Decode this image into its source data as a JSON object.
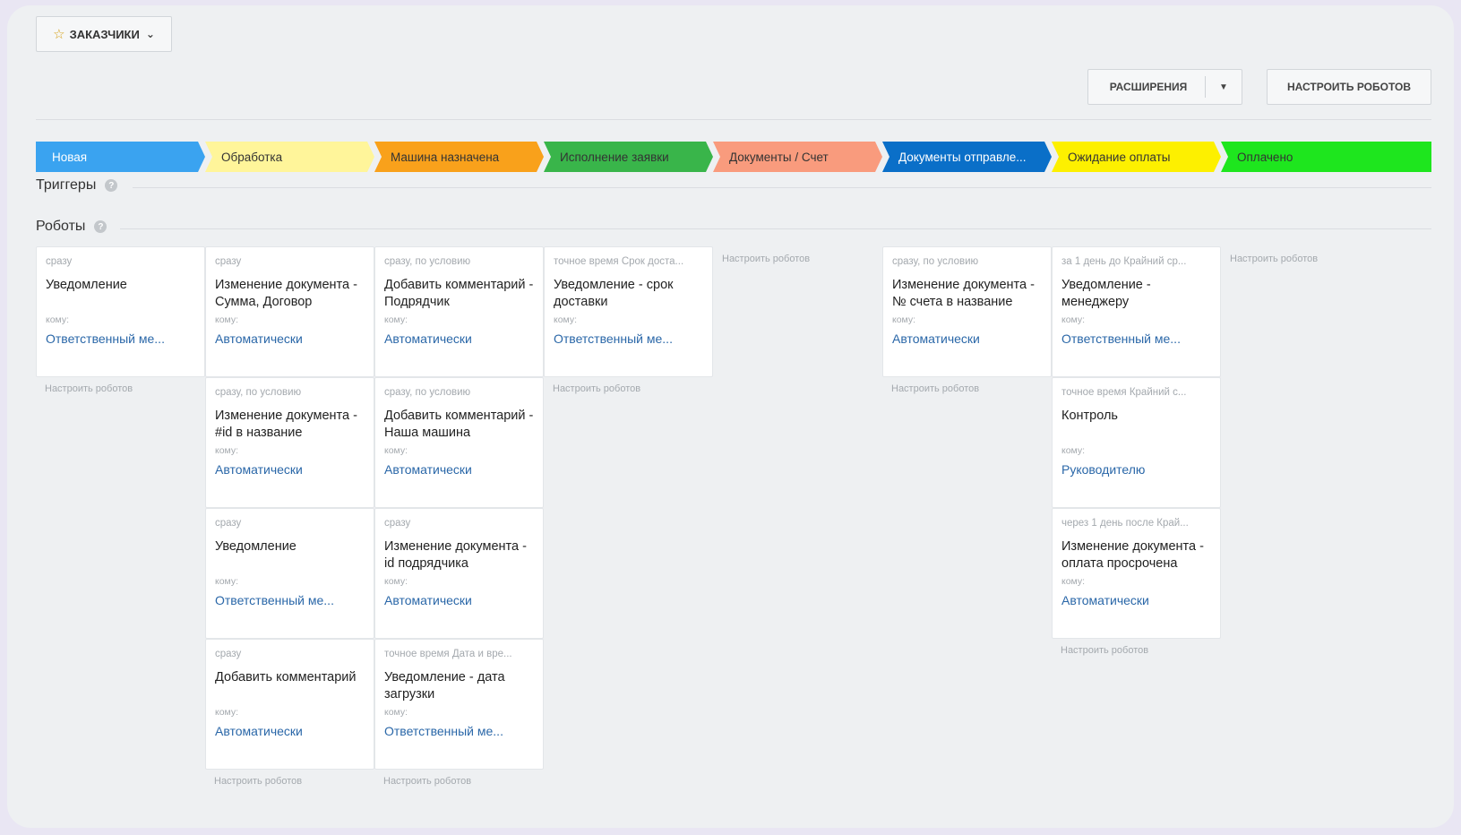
{
  "toolbar": {
    "filter_label": "ЗАКАЗЧИКИ",
    "extensions_label": "РАСШИРЕНИЯ",
    "setup_robots_label": "НАСТРОИТЬ РОБОТОВ"
  },
  "stages": [
    {
      "label": "Новая",
      "color": "#3aa3f0",
      "text_color": "#ffffff"
    },
    {
      "label": "Обработка",
      "color": "#fff59a",
      "text_color": "#333333"
    },
    {
      "label": "Машина назначена",
      "color": "#f9a11b",
      "text_color": "#333333"
    },
    {
      "label": "Исполнение заявки",
      "color": "#39b54a",
      "text_color": "#333333"
    },
    {
      "label": "Документы / Счет",
      "color": "#f99b7d",
      "text_color": "#333333"
    },
    {
      "label": "Документы отправле...",
      "color": "#0a6fc8",
      "text_color": "#ffffff"
    },
    {
      "label": "Ожидание оплаты",
      "color": "#fdf000",
      "text_color": "#333333"
    },
    {
      "label": "Оплачено",
      "color": "#1ee61e",
      "text_color": "#333333"
    }
  ],
  "sections": {
    "triggers": "Триггеры",
    "robots": "Роботы",
    "help_glyph": "?"
  },
  "to_label": "кому:",
  "setup_label": "Настроить роботов",
  "columns": [
    {
      "robots": [
        {
          "cond": "сразу",
          "title": "Уведомление",
          "who": "Ответственный ме..."
        }
      ]
    },
    {
      "robots": [
        {
          "cond": "сразу",
          "title": "Изменение документа - Сумма, Договор",
          "who": "Автоматически"
        },
        {
          "cond": "сразу, по условию",
          "title": "Изменение документа - #id в название",
          "who": "Автоматически"
        },
        {
          "cond": "сразу",
          "title": "Уведомление",
          "who": "Ответственный ме..."
        },
        {
          "cond": "сразу",
          "title": "Добавить комментарий",
          "who": "Автоматически"
        }
      ]
    },
    {
      "robots": [
        {
          "cond": "сразу, по условию",
          "title": "Добавить комментарий - Подрядчик",
          "who": "Автоматически"
        },
        {
          "cond": "сразу, по условию",
          "title": "Добавить комментарий - Наша машина",
          "who": "Автоматически"
        },
        {
          "cond": "сразу",
          "title": "Изменение документа - id подрядчика",
          "who": "Автоматически"
        },
        {
          "cond": "точное время Дата и вре...",
          "title": "Уведомление - дата загрузки",
          "who": "Ответственный ме..."
        }
      ]
    },
    {
      "robots": [
        {
          "cond": "точное время Срок доста...",
          "title": "Уведомление - срок доставки",
          "who": "Ответственный ме..."
        }
      ]
    },
    {
      "robots": []
    },
    {
      "robots": [
        {
          "cond": "сразу, по условию",
          "title": "Изменение документа - № счета в название",
          "who": "Автоматически"
        }
      ]
    },
    {
      "robots": [
        {
          "cond": "за 1 день до Крайний ср...",
          "title": "Уведомление - менеджеру",
          "who": "Ответственный ме..."
        },
        {
          "cond": "точное время Крайний с...",
          "title": "Контроль",
          "who": "Руководителю"
        },
        {
          "cond": "через 1 день после Край...",
          "title": "Изменение документа - оплата просрочена",
          "who": "Автоматически"
        }
      ]
    },
    {
      "robots": []
    }
  ]
}
